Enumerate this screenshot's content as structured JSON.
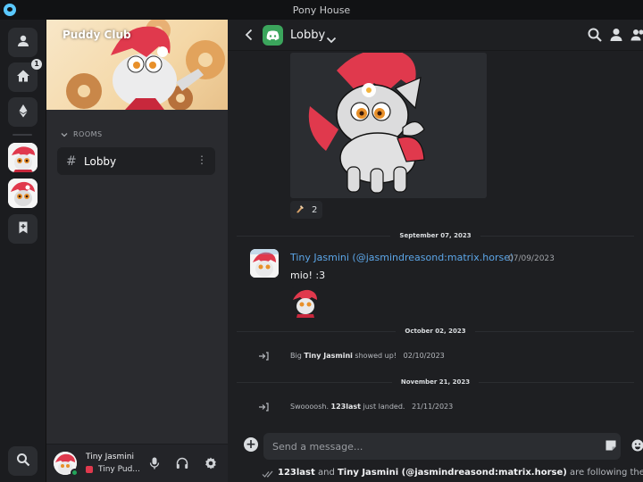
{
  "window": {
    "title": "Pony House"
  },
  "rail": {
    "home_badge": "1"
  },
  "sidebar": {
    "space_name": "Puddy Club",
    "rooms_header": "ROOMS",
    "rooms": [
      {
        "label": "Lobby"
      }
    ]
  },
  "user": {
    "name": "Tiny Jasmini",
    "status_text": "Tiny Pud..."
  },
  "room": {
    "title": "Lobby"
  },
  "timeline": {
    "reaction_count": "2",
    "date_1": "September 07, 2023",
    "message": {
      "author": "Tiny Jasmini (@jasmindreasond:matrix.horse)",
      "time": "07/09/2023",
      "body": "mio! :3"
    },
    "date_2": "October 02, 2023",
    "event_1": {
      "prefix": "Big ",
      "name": "Tiny Jasmini",
      "suffix": " showed up!",
      "time": "02/10/2023"
    },
    "date_3": "November 21, 2023",
    "event_2": {
      "prefix": "Swoooosh. ",
      "name": "123last",
      "suffix": " just landed.",
      "time": "21/11/2023"
    }
  },
  "composer": {
    "placeholder": "Send a message..."
  },
  "typing": {
    "user_1": "123last",
    "joiner": " and ",
    "user_2": "Tiny Jasmini (@jasmindreasond:matrix.horse)",
    "suffix": " are following the conve"
  },
  "colors": {
    "accent_link": "#5ca6e8",
    "online": "#23a55a",
    "room_logo": "#3ba55c",
    "pony_red": "#e0394d"
  }
}
